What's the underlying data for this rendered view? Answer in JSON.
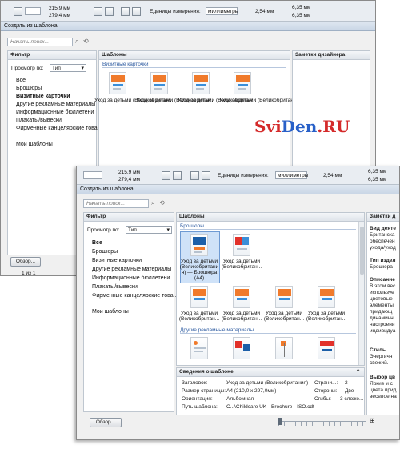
{
  "back_window": {
    "toolbar": {
      "w": "215,9 мм",
      "h": "279,4 мм",
      "units_label": "Единицы измерения:",
      "units_value": "миллиметры",
      "nudge": "2,54 мм",
      "dup_x": "6,35 мм",
      "dup_y": "6,35 мм"
    },
    "title": "Создать из шаблона",
    "search_placeholder": "Начать поиск...",
    "filter": {
      "header": "Фильтр",
      "view_label": "Просмотр по:",
      "view_value": "Тип",
      "items": [
        "Все",
        "Брошюры",
        "Визитные карточки",
        "Другие рекламные материалы",
        "Информационные бюллетени",
        "Плакаты/вывески",
        "Фирменные канцелярские товары"
      ],
      "my_templates": "Мои шаблоны"
    },
    "templates": {
      "header": "Шаблоны",
      "section": "Визитные карточки",
      "items": [
        "Уход за детьми (Великобритан...",
        "Уход за детьми (Великобритан...",
        "Уход за детьми (Великобритан...",
        "Уход за детьми (Великобритан..."
      ]
    },
    "notes_header": "Заметки дизайнера",
    "browse_button": "Обзор...",
    "status": "1 из 1"
  },
  "watermark": "SviDen.RU",
  "front_window": {
    "toolbar": {
      "w": "215,9 мм",
      "h": "279,4 мм",
      "units_label": "Единицы измерения:",
      "units_value": "миллиметры",
      "nudge": "2,54 мм",
      "dup_x": "6,35 мм",
      "dup_y": "6,35 мм"
    },
    "title": "Создать из шаблона",
    "search_placeholder": "Начать поиск...",
    "filter": {
      "header": "Фильтр",
      "view_label": "Просмотр по:",
      "view_value": "Тип",
      "items": [
        "Все",
        "Брошюры",
        "Визитные карточки",
        "Другие рекламные материалы",
        "Информационные бюллетени",
        "Плакаты/вывески",
        "Фирменные канцелярские това..."
      ],
      "my_templates": "Мои шаблоны"
    },
    "templates": {
      "header": "Шаблоны",
      "section1": "Брошюры",
      "selected_caption": [
        "Уход за детьми",
        "(Великобритани",
        "я) — Брошюра",
        "(A4)"
      ],
      "second_caption": [
        "Уход за детьми",
        "(Великобритан..."
      ],
      "row2_caption": [
        "Уход за детьми",
        "(Великобритан..."
      ],
      "section2": "Другие рекламные материалы"
    },
    "info": {
      "header": "Сведения о шаблоне",
      "rows": [
        {
          "label": "Заголовок:",
          "value": "Уход за детьми (Великобритания) —"
        },
        {
          "label": "Размер страницы:",
          "value": "A4 (210,0 x 297,0мм)"
        },
        {
          "label": "Ориентация:",
          "value": "Альбомная"
        },
        {
          "label": "Путь шаблона:",
          "value": "C...\\Childcare UK - Brochure - ISO.cdt"
        }
      ],
      "right_rows": [
        {
          "label": "Страни...:",
          "value": "2"
        },
        {
          "label": "Стороны:",
          "value": "Две"
        },
        {
          "label": "Сгибы:",
          "value": "3 сложе..."
        }
      ]
    },
    "notes": {
      "header": "Заметки д",
      "blocks": [
        {
          "title": "Вид деяте",
          "lines": [
            "Британска",
            "обеспечен",
            "ухода/уход"
          ]
        },
        {
          "title": "Тип издел",
          "lines": [
            "Брошюра"
          ]
        },
        {
          "title": "Описание",
          "lines": [
            "В этом вес",
            "используе",
            "цветовые",
            "элементы",
            "придающ",
            "динамичн",
            "настроени",
            "индивидуа"
          ]
        },
        {
          "title": "Стиль",
          "lines": [
            "Энергичн",
            "свежий."
          ]
        },
        {
          "title": "Выбор цв",
          "lines": [
            "Яркие и с",
            "цвета прид",
            "веселое на"
          ]
        }
      ]
    },
    "browse_button": "Обзор..."
  }
}
